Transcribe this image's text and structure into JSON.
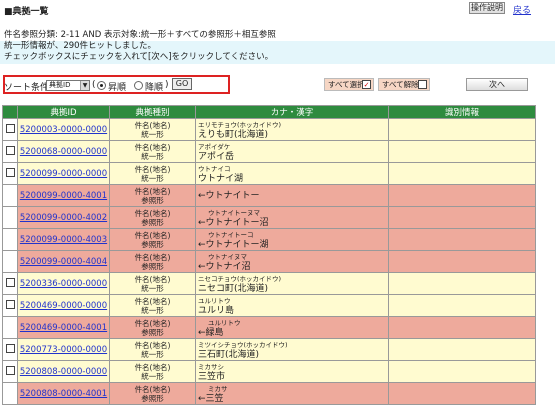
{
  "header": {
    "title": "■典拠一覧",
    "help_label": "操作説明",
    "back_label": "戻る"
  },
  "search": {
    "condition": "件名参照分類: 2-11 AND 表示対象:統一形＋すべての参照形＋相互参照"
  },
  "info": {
    "line1": "統一形情報が、290件ヒットしました。",
    "line2": "チェックボックスにチェックを入れて[次へ]をクリックしてください。"
  },
  "sort": {
    "label": "ソート条件",
    "selected": "典拠ID",
    "paren_open": "(",
    "asc_label": "昇順",
    "desc_label": "降順",
    "paren_close": ")",
    "go_label": "GO"
  },
  "actions": {
    "select_all": "すべて選択",
    "deselect_all": "すべて解除",
    "next": "次へ"
  },
  "table": {
    "headers": [
      "",
      "典拠ID",
      "典拠種別",
      "カナ・漢字",
      "識別情報"
    ],
    "rows": [
      {
        "id": "5200003-0000-0000",
        "type1": "件名(地名)",
        "type2": "統一形",
        "kana": "エリモチョウ(ホッカイドウ)",
        "kanji": "えりも町(北海道)",
        "checkbox": true,
        "style": "y"
      },
      {
        "id": "5200068-0000-0000",
        "type1": "件名(地名)",
        "type2": "統一形",
        "kana": "アポイダケ",
        "kanji": "アポイ岳",
        "checkbox": true,
        "style": "y"
      },
      {
        "id": "5200099-0000-0000",
        "type1": "件名(地名)",
        "type2": "統一形",
        "kana": "ウトナイコ",
        "kanji": "ウトナイ湖",
        "checkbox": true,
        "style": "y"
      },
      {
        "id": "5200099-0000-4001",
        "type1": "件名(地名)",
        "type2": "参照形",
        "kana": "",
        "kanji": "←ウトナイトー",
        "checkbox": false,
        "style": "p"
      },
      {
        "id": "5200099-0000-4002",
        "type1": "件名(地名)",
        "type2": "参照形",
        "kana": "ウトナイトーヌマ",
        "kanji": "←ウトナイトー沼",
        "checkbox": false,
        "style": "p"
      },
      {
        "id": "5200099-0000-4003",
        "type1": "件名(地名)",
        "type2": "参照形",
        "kana": "ウトナイトーコ",
        "kanji": "←ウトナイトー湖",
        "checkbox": false,
        "style": "p"
      },
      {
        "id": "5200099-0000-4004",
        "type1": "件名(地名)",
        "type2": "参照形",
        "kana": "ウトナイヌマ",
        "kanji": "←ウトナイ沼",
        "checkbox": false,
        "style": "p"
      },
      {
        "id": "5200336-0000-0000",
        "type1": "件名(地名)",
        "type2": "統一形",
        "kana": "ニセコチョウ(ホッカイドウ)",
        "kanji": "ニセコ町(北海道)",
        "checkbox": true,
        "style": "y"
      },
      {
        "id": "5200469-0000-0000",
        "type1": "件名(地名)",
        "type2": "統一形",
        "kana": "ユルリトウ",
        "kanji": "ユルリ島",
        "checkbox": true,
        "style": "y"
      },
      {
        "id": "5200469-0000-4001",
        "type1": "件名(地名)",
        "type2": "参照形",
        "kana": "ユルリトウ",
        "kanji": "←緑島",
        "checkbox": false,
        "style": "p"
      },
      {
        "id": "5200773-0000-0000",
        "type1": "件名(地名)",
        "type2": "統一形",
        "kana": "ミツイシチョウ(ホッカイドウ)",
        "kanji": "三石町(北海道)",
        "checkbox": true,
        "style": "y"
      },
      {
        "id": "5200808-0000-0000",
        "type1": "件名(地名)",
        "type2": "統一形",
        "kana": "ミカサシ",
        "kanji": "三笠市",
        "checkbox": true,
        "style": "y"
      },
      {
        "id": "5200808-0000-4001",
        "type1": "件名(地名)",
        "type2": "参照形",
        "kana": "ミカサ",
        "kanji": "←三笠",
        "checkbox": false,
        "style": "p"
      }
    ]
  }
}
